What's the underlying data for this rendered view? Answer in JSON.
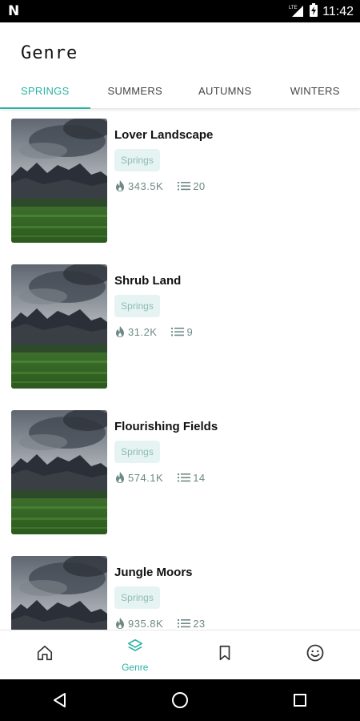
{
  "status_bar": {
    "left_icon": "N",
    "signal_label": "LTE",
    "time": "11:42"
  },
  "header": {
    "title": "Genre"
  },
  "tabs": [
    {
      "label": "SPRINGS",
      "active": true
    },
    {
      "label": "SUMMERS",
      "active": false
    },
    {
      "label": "AUTUMNS",
      "active": false
    },
    {
      "label": "WINTERS",
      "active": false
    }
  ],
  "items": [
    {
      "title": "Lover Landscape",
      "tag": "Springs",
      "views": "343.5K",
      "chapters": "20"
    },
    {
      "title": "Shrub Land",
      "tag": "Springs",
      "views": "31.2K",
      "chapters": "9"
    },
    {
      "title": "Flourishing Fields",
      "tag": "Springs",
      "views": "574.1K",
      "chapters": "14"
    },
    {
      "title": "Jungle Moors",
      "tag": "Springs",
      "views": "935.8K",
      "chapters": "23"
    }
  ],
  "bottom_nav": [
    {
      "icon": "home-icon",
      "label": ""
    },
    {
      "icon": "layers-icon",
      "label": "Genre",
      "active": true
    },
    {
      "icon": "bookmark-icon",
      "label": ""
    },
    {
      "icon": "smiley-icon",
      "label": ""
    }
  ],
  "colors": {
    "accent": "#2bb3a3",
    "tag_bg": "#e5f4f2",
    "tag_text": "#8fbab4",
    "stat_text": "#6e8a87"
  }
}
